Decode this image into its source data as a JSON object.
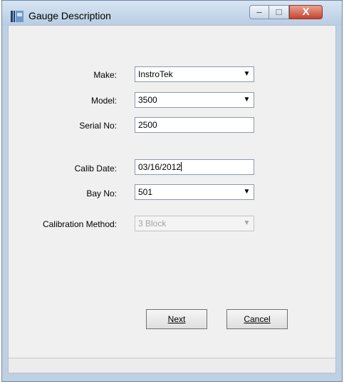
{
  "window": {
    "title": "Gauge Description",
    "icon": "app-icon"
  },
  "window_controls": {
    "minimize": "–",
    "maximize": "□",
    "close": "X"
  },
  "form": {
    "make": {
      "label": "Make:",
      "value": "InstroTek"
    },
    "model": {
      "label": "Model:",
      "value": "3500"
    },
    "serial": {
      "label": "Serial No:",
      "value": "2500"
    },
    "calib_date": {
      "label": "Calib Date:",
      "value": "03/16/2012"
    },
    "bay": {
      "label": "Bay No:",
      "value": "501"
    },
    "calibration_method": {
      "label": "Calibration Method:",
      "value": "3 Block"
    }
  },
  "buttons": {
    "next": "Next",
    "cancel": "Cancel"
  },
  "dropdown_arrow": "▼"
}
